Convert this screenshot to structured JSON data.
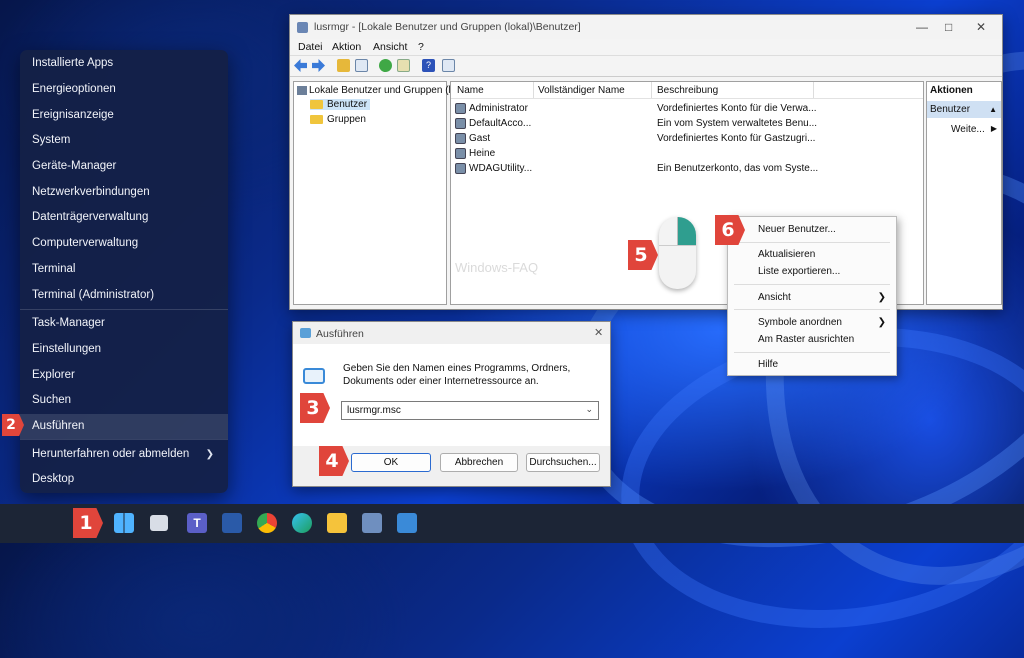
{
  "start_menu": {
    "items": [
      {
        "label": "Installierte Apps"
      },
      {
        "label": "Energieoptionen"
      },
      {
        "label": "Ereignisanzeige"
      },
      {
        "label": "System"
      },
      {
        "label": "Geräte-Manager"
      },
      {
        "label": "Netzwerkverbindungen"
      },
      {
        "label": "Datenträgerverwaltung"
      },
      {
        "label": "Computerverwaltung"
      },
      {
        "label": "Terminal"
      },
      {
        "label": "Terminal (Administrator)"
      },
      {
        "label": "Task-Manager"
      },
      {
        "label": "Einstellungen"
      },
      {
        "label": "Explorer"
      },
      {
        "label": "Suchen"
      },
      {
        "label": "Ausführen"
      },
      {
        "label": "Herunterfahren oder abmelden"
      },
      {
        "label": "Desktop"
      }
    ]
  },
  "badges": {
    "b1": "1",
    "b2": "2",
    "b3": "3",
    "b4": "4",
    "b5": "5",
    "b6": "6"
  },
  "mmc": {
    "title": "lusrmgr - [Lokale Benutzer und Gruppen (lokal)\\Benutzer]",
    "menu": [
      "Datei",
      "Aktion",
      "Ansicht",
      "?"
    ],
    "tree": {
      "root": "Lokale Benutzer und Gruppen (lo",
      "child1": "Benutzer",
      "child2": "Gruppen"
    },
    "columns": {
      "name": "Name",
      "fullname": "Vollständiger Name",
      "desc": "Beschreibung"
    },
    "users": [
      {
        "name": "Administrator",
        "fullname": "",
        "desc": "Vordefiniertes Konto für die Verwa..."
      },
      {
        "name": "DefaultAcco...",
        "fullname": "",
        "desc": "Ein vom System verwaltetes Benu..."
      },
      {
        "name": "Gast",
        "fullname": "",
        "desc": "Vordefiniertes Konto für Gastzugri..."
      },
      {
        "name": "Heine",
        "fullname": "",
        "desc": ""
      },
      {
        "name": "WDAGUtility...",
        "fullname": "",
        "desc": "Ein Benutzerkonto, das vom Syste..."
      }
    ],
    "actions": {
      "header": "Aktionen",
      "section": "Benutzer",
      "more": "Weite..."
    },
    "watermark": "Windows-FAQ"
  },
  "context_menu": {
    "new_user": "Neuer Benutzer...",
    "refresh": "Aktualisieren",
    "export": "Liste exportieren...",
    "view": "Ansicht",
    "arrange": "Symbole anordnen",
    "align": "Am Raster ausrichten",
    "help": "Hilfe"
  },
  "run_dialog": {
    "title": "Ausführen",
    "description": "Geben Sie den Namen eines Programms, Ordners, Dokuments oder einer Internetressource an.",
    "input_value": "lusrmgr.msc",
    "ok": "OK",
    "cancel": "Abbrechen",
    "browse": "Durchsuchen..."
  },
  "colors": {
    "badge": "#e0453b",
    "accent": "#2f9e8f",
    "selection": "#cce4f7"
  }
}
